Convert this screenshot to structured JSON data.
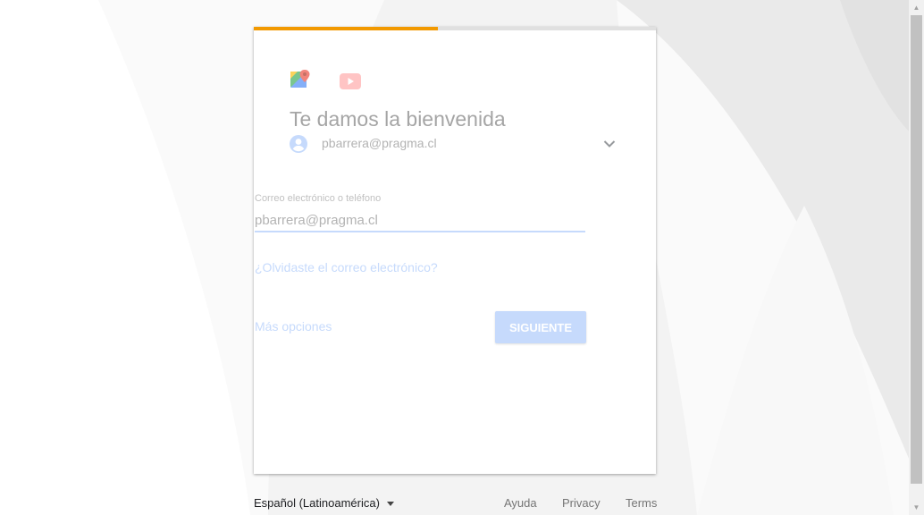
{
  "card": {
    "progress_fraction": 0.457,
    "title": "Te damos la bienvenida",
    "account_email": "pbarrera@pragma.cl",
    "field_label": "Correo electrónico o teléfono",
    "field_value": "pbarrera@pragma.cl",
    "forgot_link": "¿Olvidaste el correo electrónico?",
    "more_options": "Más opciones",
    "next_button": "SIGUIENTE"
  },
  "footer": {
    "language": "Español (Latinoamérica)",
    "help": "Ayuda",
    "privacy": "Privacy",
    "terms": "Terms"
  },
  "colors": {
    "progress": "#f29900",
    "accent_disabled": "#a8c7fa"
  },
  "icons": {
    "maps": "google-maps-icon",
    "youtube": "youtube-icon",
    "avatar": "account-circle-icon",
    "chevron": "chevron-down-icon",
    "caret": "caret-down-icon"
  }
}
